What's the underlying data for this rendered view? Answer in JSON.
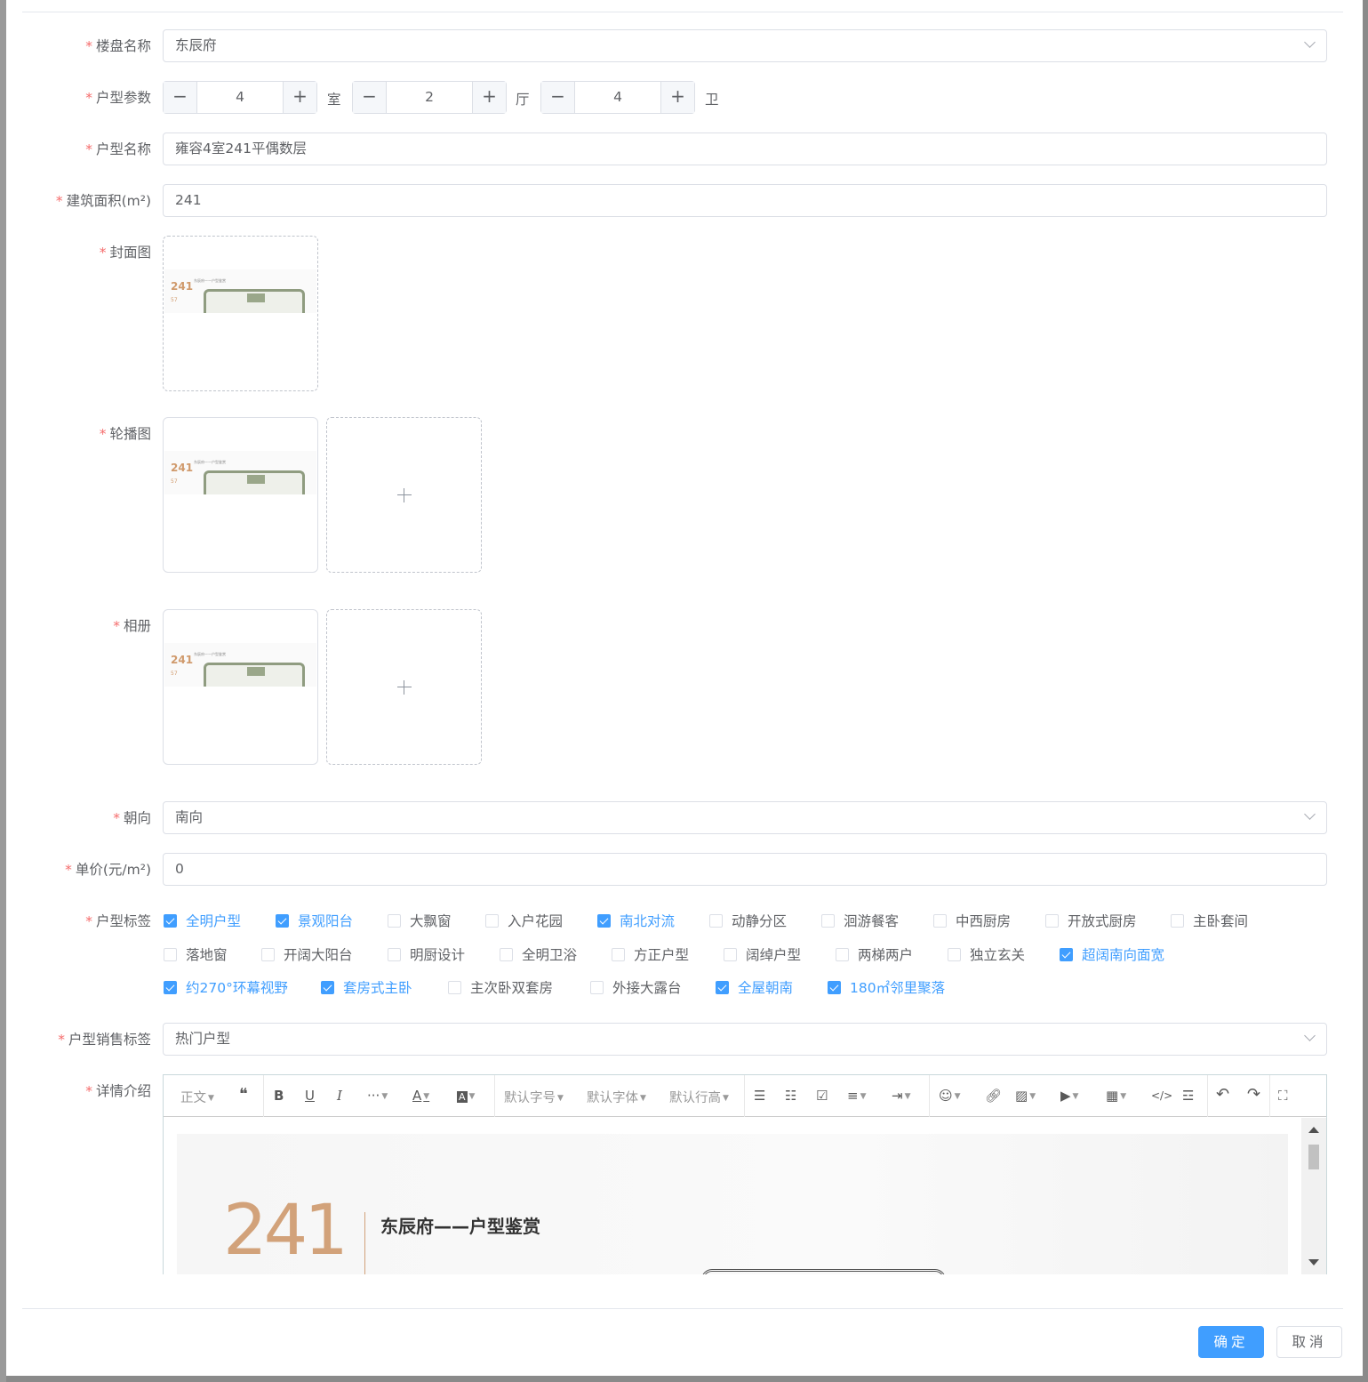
{
  "form": {
    "estate": {
      "label": "楼盘名称",
      "value": "东辰府"
    },
    "layout_params": {
      "label": "户型参数",
      "rooms": "4",
      "halls": "2",
      "baths": "4",
      "room_unit": "室",
      "hall_unit": "厅",
      "bath_unit": "卫",
      "minus": "−",
      "plus": "+"
    },
    "layout_name": {
      "label": "户型名称",
      "value": "雍容4室241平偶数层"
    },
    "area": {
      "label": "建筑面积(m²)",
      "value": "241"
    },
    "cover": {
      "label": "封面图"
    },
    "carousel": {
      "label": "轮播图"
    },
    "album": {
      "label": "相册"
    },
    "orientation": {
      "label": "朝向",
      "value": "南向"
    },
    "price": {
      "label": "单价(元/m²)",
      "value": "0"
    },
    "tags": {
      "label": "户型标签",
      "items": [
        {
          "text": "全明户型",
          "checked": true
        },
        {
          "text": "景观阳台",
          "checked": true
        },
        {
          "text": "大飘窗",
          "checked": false
        },
        {
          "text": "入户花园",
          "checked": false
        },
        {
          "text": "南北对流",
          "checked": true
        },
        {
          "text": "动静分区",
          "checked": false
        },
        {
          "text": "洄游餐客",
          "checked": false
        },
        {
          "text": "中西厨房",
          "checked": false
        },
        {
          "text": "开放式厨房",
          "checked": false
        },
        {
          "text": "主卧套间",
          "checked": false
        },
        {
          "text": "落地窗",
          "checked": false
        },
        {
          "text": "开阔大阳台",
          "checked": false
        },
        {
          "text": "明厨设计",
          "checked": false
        },
        {
          "text": "全明卫浴",
          "checked": false
        },
        {
          "text": "方正户型",
          "checked": false
        },
        {
          "text": "阔绰户型",
          "checked": false
        },
        {
          "text": "两梯两户",
          "checked": false
        },
        {
          "text": "独立玄关",
          "checked": false
        },
        {
          "text": "超阔南向面宽",
          "checked": true
        },
        {
          "text": "约270°环幕视野",
          "checked": true
        },
        {
          "text": "套房式主卧",
          "checked": true
        },
        {
          "text": "主次卧双套房",
          "checked": false
        },
        {
          "text": "外接大露台",
          "checked": false
        },
        {
          "text": "全屋朝南",
          "checked": true
        },
        {
          "text": "180㎡邻里聚落",
          "checked": true
        }
      ]
    },
    "sales_tag": {
      "label": "户型销售标签",
      "value": "热门户型"
    },
    "detail": {
      "label": "详情介绍",
      "toolbar": {
        "para": "正文",
        "font_size": "默认字号",
        "font_family": "默认字体",
        "line_height": "默认行高"
      },
      "poster_number": "241",
      "poster_title": "东辰府——户型鉴赏"
    }
  },
  "thumbnail": {
    "number": "241",
    "sub": "57",
    "heading": "东辰府——户型鉴赏"
  },
  "buttons": {
    "confirm": "确定",
    "cancel": "取消"
  },
  "colors": {
    "primary": "#409eff",
    "required": "#f56c6c",
    "text": "#606266"
  }
}
